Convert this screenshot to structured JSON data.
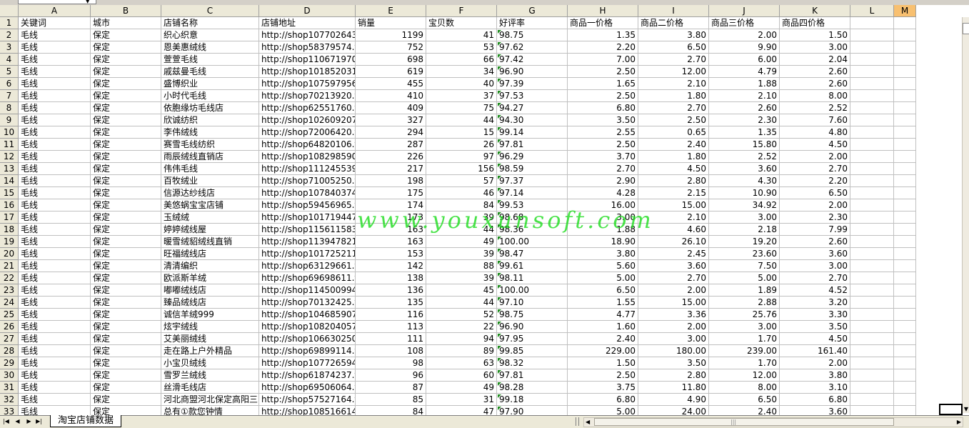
{
  "namebox_text": "___",
  "columns": [
    {
      "letter": "",
      "w": 25,
      "pad": 0
    },
    {
      "letter": "A",
      "w": 100,
      "pad": 3
    },
    {
      "letter": "B",
      "w": 98,
      "pad": 3
    },
    {
      "letter": "C",
      "w": 136,
      "pad": 3
    },
    {
      "letter": "D",
      "w": 134,
      "pad": 3
    },
    {
      "letter": "E",
      "w": 98,
      "pad": 3
    },
    {
      "letter": "F",
      "w": 98,
      "pad": 3
    },
    {
      "letter": "G",
      "w": 98,
      "pad": 3
    },
    {
      "letter": "H",
      "w": 98,
      "pad": 3
    },
    {
      "letter": "I",
      "w": 98,
      "pad": 3
    },
    {
      "letter": "J",
      "w": 98,
      "pad": 3
    },
    {
      "letter": "K",
      "w": 98,
      "pad": 3
    },
    {
      "letter": "L",
      "w": 60,
      "pad": 3
    },
    {
      "letter": "M",
      "w": 30,
      "pad": 0
    }
  ],
  "header_row": [
    "关键词",
    "城市",
    "店铺名称",
    "店铺地址",
    "销量",
    "宝贝数",
    "好评率",
    "商品一价格",
    "商品二价格",
    "商品三价格",
    "商品四价格"
  ],
  "rows": [
    [
      "2",
      "毛线",
      "保定",
      "织心织意",
      "http://shop107702643.ta",
      "1199",
      "41",
      "98.75",
      "1.35",
      "3.80",
      "2.00",
      "1.50"
    ],
    [
      "3",
      "毛线",
      "保定",
      "恩美惠绒线",
      "http://shop58379574.tac",
      "752",
      "53",
      "97.62",
      "2.20",
      "6.50",
      "9.90",
      "3.00"
    ],
    [
      "4",
      "毛线",
      "保定",
      "萱萱毛线",
      "http://shop110671970.ta",
      "698",
      "66",
      "97.42",
      "7.00",
      "2.70",
      "6.00",
      "2.04"
    ],
    [
      "5",
      "毛线",
      "保定",
      "戚兹曼毛线",
      "http://shop101852031.ta",
      "619",
      "34",
      "96.90",
      "2.50",
      "12.00",
      "4.79",
      "2.60"
    ],
    [
      "6",
      "毛线",
      "保定",
      "盛博织业",
      "http://shop107597956.ta",
      "455",
      "40",
      "97.39",
      "1.65",
      "2.10",
      "1.88",
      "2.60"
    ],
    [
      "7",
      "毛线",
      "保定",
      "小时代毛线",
      "http://shop70213920.tac",
      "410",
      "37",
      "97.53",
      "2.50",
      "1.80",
      "2.10",
      "8.00"
    ],
    [
      "8",
      "毛线",
      "保定",
      "依胞缘坊毛线店",
      "http://shop62551760.tac",
      "409",
      "75",
      "94.27",
      "6.80",
      "2.70",
      "2.60",
      "2.52"
    ],
    [
      "9",
      "毛线",
      "保定",
      "欣诚纺织",
      "http://shop102609207.ta",
      "327",
      "44",
      "94.30",
      "3.50",
      "2.50",
      "2.30",
      "7.60"
    ],
    [
      "10",
      "毛线",
      "保定",
      "李伟绒线",
      "http://shop72006420.tac",
      "294",
      "15",
      "99.14",
      "2.55",
      "0.65",
      "1.35",
      "4.80"
    ],
    [
      "11",
      "毛线",
      "保定",
      "赛雪毛线纺织",
      "http://shop64820106.tac",
      "287",
      "26",
      "97.81",
      "2.50",
      "2.40",
      "15.80",
      "4.50"
    ],
    [
      "12",
      "毛线",
      "保定",
      "雨辰绒线直销店",
      "http://shop108298590.ta",
      "226",
      "97",
      "96.29",
      "3.70",
      "1.80",
      "2.52",
      "2.00"
    ],
    [
      "13",
      "毛线",
      "保定",
      "伟伟毛线",
      "http://shop111245539.ta",
      "217",
      "156",
      "98.59",
      "2.70",
      "4.50",
      "3.60",
      "2.70"
    ],
    [
      "14",
      "毛线",
      "保定",
      "百牧绒业",
      "http://shop71005250.tac",
      "198",
      "57",
      "97.37",
      "2.90",
      "2.80",
      "4.30",
      "2.20"
    ],
    [
      "15",
      "毛线",
      "保定",
      "信源达纱线店",
      "http://shop107840374.ta",
      "175",
      "46",
      "97.14",
      "4.28",
      "2.15",
      "10.90",
      "6.50"
    ],
    [
      "16",
      "毛线",
      "保定",
      "美悠蜗宝宝店铺",
      "http://shop59456965.tac",
      "174",
      "84",
      "99.53",
      "16.00",
      "15.00",
      "34.92",
      "2.00"
    ],
    [
      "17",
      "毛线",
      "保定",
      "玉绒绒",
      "http://shop101719447.ta",
      "173",
      "39",
      "98.68",
      "3.00",
      "2.10",
      "3.00",
      "2.30"
    ],
    [
      "18",
      "毛线",
      "保定",
      "婷婷绒线屋",
      "http://shop115611583.ta",
      "163",
      "44",
      "98.36",
      "1.88",
      "4.60",
      "2.18",
      "7.99"
    ],
    [
      "19",
      "毛线",
      "保定",
      "暖雪绒貂绒线直销",
      "http://shop113947821.ta",
      "163",
      "49",
      "100.00",
      "18.90",
      "26.10",
      "19.20",
      "2.60"
    ],
    [
      "20",
      "毛线",
      "保定",
      "旺福绒线店",
      "http://shop101725211.ta",
      "153",
      "39",
      "98.47",
      "3.80",
      "2.45",
      "23.60",
      "3.60"
    ],
    [
      "21",
      "毛线",
      "保定",
      "清清编织",
      "http://shop63129661.tac",
      "142",
      "88",
      "99.61",
      "5.60",
      "3.60",
      "7.50",
      "3.00"
    ],
    [
      "22",
      "毛线",
      "保定",
      "欧派斯羊绒",
      "http://shop69698611.tac",
      "138",
      "39",
      "98.11",
      "5.00",
      "2.70",
      "5.00",
      "2.70"
    ],
    [
      "23",
      "毛线",
      "保定",
      "嘟嘟绒线店",
      "http://shop114500994.ta",
      "136",
      "45",
      "100.00",
      "6.50",
      "2.00",
      "1.89",
      "4.52"
    ],
    [
      "24",
      "毛线",
      "保定",
      "臻品绒线店",
      "http://shop70132425.tac",
      "135",
      "44",
      "97.10",
      "1.55",
      "15.00",
      "2.88",
      "3.20"
    ],
    [
      "25",
      "毛线",
      "保定",
      "诚信羊绒999",
      "http://shop104685907.ta",
      "116",
      "52",
      "98.75",
      "4.77",
      "3.36",
      "25.76",
      "3.30"
    ],
    [
      "26",
      "毛线",
      "保定",
      "炫宇绒线",
      "http://shop108204057.ta",
      "113",
      "22",
      "96.90",
      "1.60",
      "2.00",
      "3.00",
      "3.50"
    ],
    [
      "27",
      "毛线",
      "保定",
      "艾美丽绒线",
      "http://shop106630250.ta",
      "111",
      "94",
      "97.95",
      "2.40",
      "3.00",
      "1.70",
      "4.50"
    ],
    [
      "28",
      "毛线",
      "保定",
      "走在路上户外精品",
      "http://shop69899114.tac",
      "108",
      "89",
      "99.85",
      "229.00",
      "180.00",
      "239.00",
      "161.40"
    ],
    [
      "29",
      "毛线",
      "保定",
      "小宝贝绒线",
      "http://shop107726594.ta",
      "98",
      "63",
      "98.32",
      "1.50",
      "3.50",
      "1.70",
      "2.00"
    ],
    [
      "30",
      "毛线",
      "保定",
      "雪罗兰绒线",
      "http://shop61874237.tac",
      "96",
      "60",
      "97.81",
      "2.50",
      "2.80",
      "12.00",
      "3.80"
    ],
    [
      "31",
      "毛线",
      "保定",
      "丝滑毛线店",
      "http://shop69506064.tac",
      "87",
      "49",
      "98.28",
      "3.75",
      "11.80",
      "8.00",
      "3.10"
    ],
    [
      "32",
      "毛线",
      "保定",
      "河北商盟河北保定高阳三",
      "http://shop57527164.tac",
      "85",
      "31",
      "99.18",
      "6.80",
      "4.90",
      "6.50",
      "6.80"
    ],
    [
      "33",
      "毛线",
      "保定",
      "总有①款您钟情",
      "http://shop108516614.ta",
      "84",
      "47",
      "97.90",
      "5.00",
      "24.00",
      "2.40",
      "3.60"
    ]
  ],
  "sheet_tab": "淘宝店铺数据",
  "watermark": "www.youxunsoft.com",
  "colors": {
    "header_bg": "#ece9d8",
    "grid": "#c0c0c0",
    "selected_col": "#f8c070",
    "watermark": "#1edc1e",
    "comment_tri": "#1e8c1e"
  },
  "nav_icons": [
    "first-sheet-icon",
    "prev-sheet-icon",
    "next-sheet-icon",
    "last-sheet-icon"
  ]
}
